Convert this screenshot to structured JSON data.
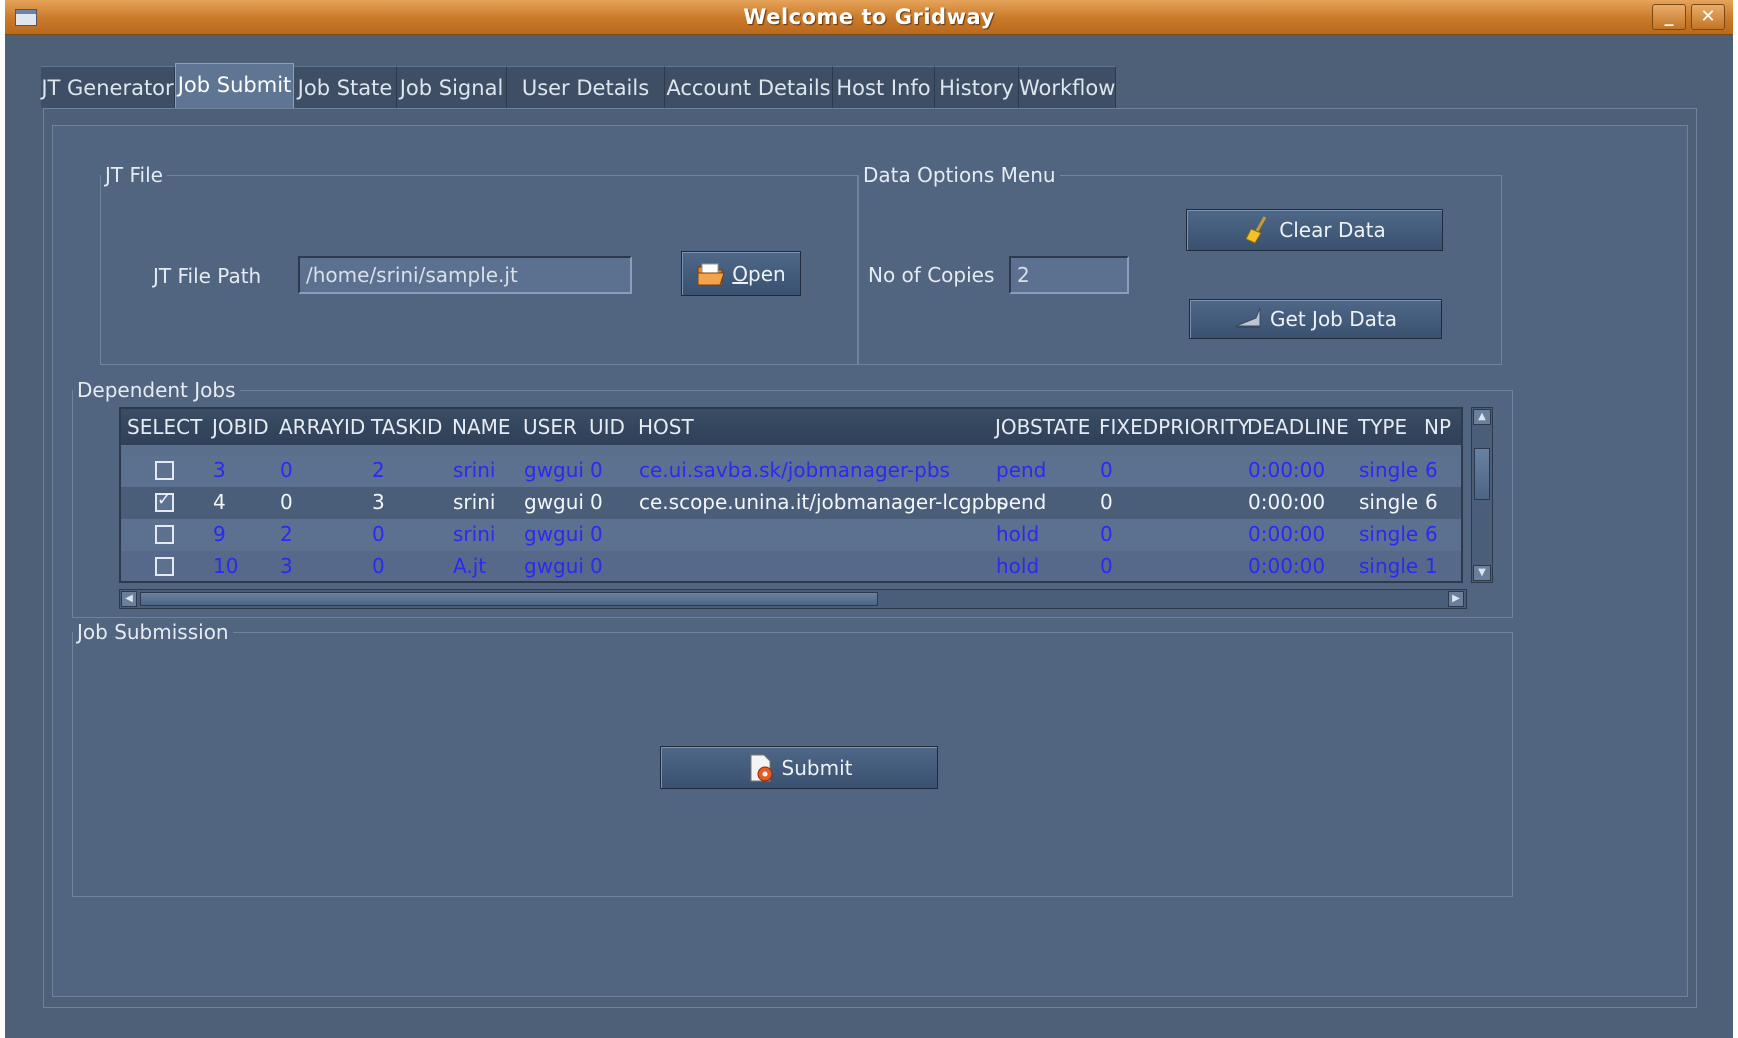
{
  "window": {
    "title": "Welcome to Gridway",
    "minimize": "_",
    "close": "✕"
  },
  "tabs": [
    {
      "label": "JT Generator"
    },
    {
      "label": "Job Submit",
      "active": true
    },
    {
      "label": "Job State"
    },
    {
      "label": "Job Signal"
    },
    {
      "label": "User Details"
    },
    {
      "label": "Account Details"
    },
    {
      "label": "Host Info"
    },
    {
      "label": "History"
    },
    {
      "label": "Workflow"
    }
  ],
  "jt_file": {
    "legend": "JT File",
    "path_label": "JT File Path",
    "path_value": "/home/srini/sample.jt",
    "open_button": "Open"
  },
  "data_options": {
    "legend": "Data Options Menu",
    "copies_label": "No of Copies",
    "copies_value": "2",
    "clear_button": "Clear Data",
    "get_button": "Get Job Data"
  },
  "dependent_jobs": {
    "legend": "Dependent Jobs",
    "columns": [
      "SELECT",
      "JOBID",
      "ARRAYID",
      "TASKID",
      "NAME",
      "USER",
      "UID",
      "HOST",
      "JOBSTATE",
      "FIXEDPRIORITY",
      "DEADLINE",
      "TYPE",
      "NP"
    ],
    "rows": [
      {
        "selected": false,
        "jobid": "3",
        "arrayid": "0",
        "taskid": "2",
        "name": "srini",
        "user": "gwgui",
        "uid": "0",
        "host": "ce.ui.savba.sk/jobmanager-pbs",
        "jobstate": "pend",
        "fixedpriority": "0",
        "deadline": "0:00:00",
        "type": "single",
        "np": "6"
      },
      {
        "selected": true,
        "jobid": "4",
        "arrayid": "0",
        "taskid": "3",
        "name": "srini",
        "user": "gwgui",
        "uid": "0",
        "host": "ce.scope.unina.it/jobmanager-lcgpbs",
        "jobstate": "pend",
        "fixedpriority": "0",
        "deadline": "0:00:00",
        "type": "single",
        "np": "6"
      },
      {
        "selected": false,
        "jobid": "9",
        "arrayid": "2",
        "taskid": "0",
        "name": "srini",
        "user": "gwgui",
        "uid": "0",
        "host": "",
        "jobstate": "hold",
        "fixedpriority": "0",
        "deadline": "0:00:00",
        "type": "single",
        "np": "6"
      },
      {
        "selected": false,
        "jobid": "10",
        "arrayid": "3",
        "taskid": "0",
        "name": "A.jt",
        "user": "gwgui",
        "uid": "0",
        "host": "",
        "jobstate": "hold",
        "fixedpriority": "0",
        "deadline": "0:00:00",
        "type": "single",
        "np": "1"
      }
    ]
  },
  "job_submission": {
    "legend": "Job Submission",
    "submit_button": "Submit"
  },
  "colors": {
    "titlebar": "#c97928",
    "background": "#4e6078",
    "link_text": "#2a2af0"
  },
  "icons": {
    "open": "folder-open-icon",
    "clear": "broom-icon",
    "get": "vacuum-icon",
    "submit": "document-gear-icon"
  }
}
